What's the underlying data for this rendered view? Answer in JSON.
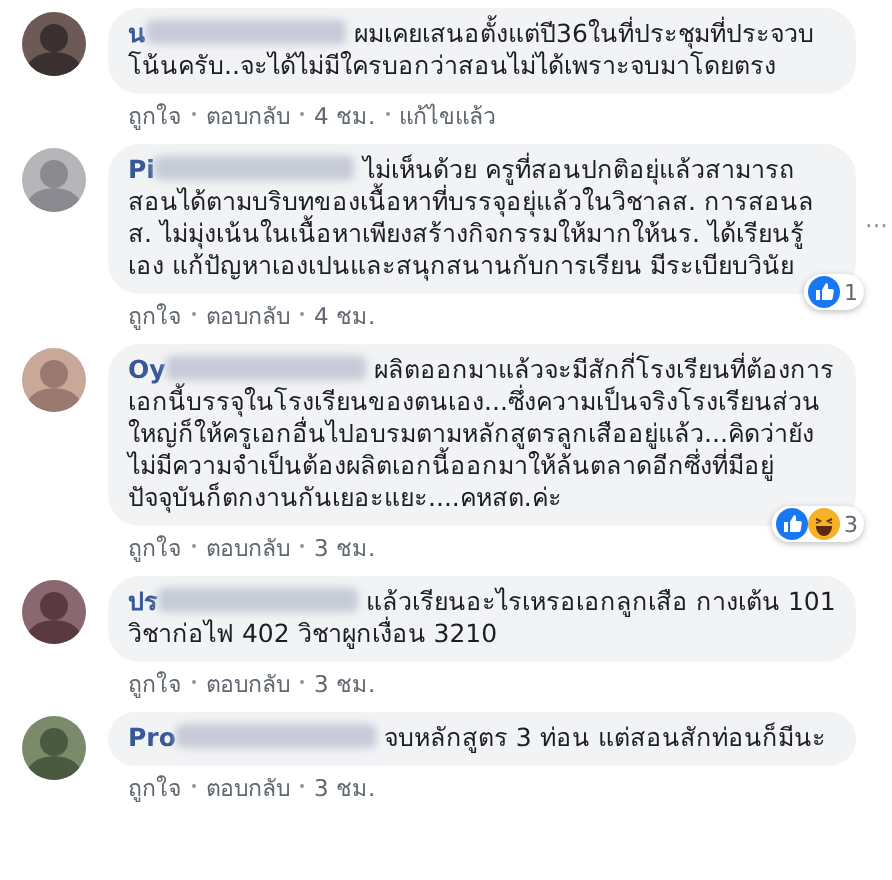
{
  "comments": [
    {
      "author": "น",
      "text": "ผมเคยเสนอตั้งแต่ปี36ในที่ประชุมที่ประจวบโน้นครับ..จะได้ไม่มีใครบอกว่าสอนไม่ได้เพราะจบมาโดยตรง",
      "actions": [
        "ถูกใจ",
        "ตอบกลับ",
        "4 ชม.",
        "แก้ไขแล้ว"
      ]
    },
    {
      "author": "Pi",
      "text": "ไม่เห็นด้วย ครูที่สอนปกติอยุ่แล้วสามารถสอนได้ตามบริบทของเนื้อหาที่บรรจุอยุ่แล้วในวิชาลส. การสอนลส. ไม่มุ่งเน้นในเนื้อหาเพียงสร้างกิจกรรมให้มากให้นร. ได้เรียนรู้เอง แก้ปัญหาเองเปนและสนุกสนานกับการเรียน มีระเบียบวินัย",
      "actions": [
        "ถูกใจ",
        "ตอบกลับ",
        "4 ชม."
      ],
      "reactions": [
        {
          "kind": "like"
        }
      ],
      "reaction_count": "1",
      "menu": "···"
    },
    {
      "author": "Oy",
      "text": "ผลิตออกมาแล้วจะมีสักกี่โรงเรียนที่ต้องการเอกนี้บรรจุในโรงเรียนของตนเอง...ซึ่งความเป็นจริงโรงเรียนส่วนใหญ่ก็ให้ครูเอกอื่นไปอบรมตามหลักสูตรลูกเสืออยู่แล้ว...คิดว่ายังไม่มีความจำเป็นต้องผลิตเอกนี้ออกมาให้ล้นตลาดอีกซึ่งที่มีอยู่ปัจจุบันก็ตกงานกันเยอะแยะ....คหสต.ค่ะ",
      "actions": [
        "ถูกใจ",
        "ตอบกลับ",
        "3 ชม."
      ],
      "reactions": [
        {
          "kind": "like"
        },
        {
          "kind": "haha"
        }
      ],
      "reaction_count": "3"
    },
    {
      "author": "ปร",
      "text": "แล้วเรียนอะไรเหรอเอกลูกเสือ กางเต้น 101 วิชาก่อไฟ 402 วิชาผูกเงื่อน 3210",
      "actions": [
        "ถูกใจ",
        "ตอบกลับ",
        "3 ชม."
      ]
    },
    {
      "author": "Pro",
      "text": "จบหลักสูตร 3 ท่อน แต่สอนสักท่อนก็มีนะ",
      "actions": [
        "ถูกใจ",
        "ตอบกลับ",
        "3 ชม."
      ]
    }
  ]
}
